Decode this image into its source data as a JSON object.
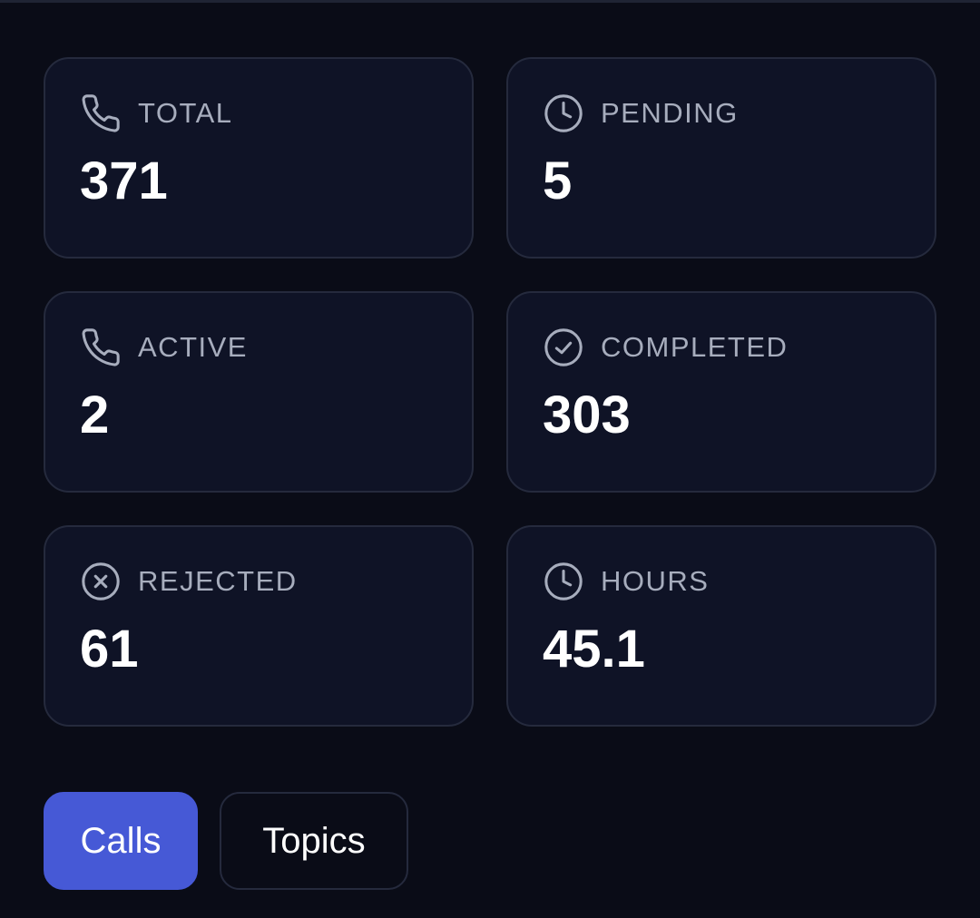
{
  "stats": [
    {
      "label": "TOTAL",
      "value": "371",
      "icon": "phone-icon"
    },
    {
      "label": "PENDING",
      "value": "5",
      "icon": "clock-icon"
    },
    {
      "label": "ACTIVE",
      "value": "2",
      "icon": "phone-icon"
    },
    {
      "label": "COMPLETED",
      "value": "303",
      "icon": "check-circle-icon"
    },
    {
      "label": "REJECTED",
      "value": "61",
      "icon": "x-circle-icon"
    },
    {
      "label": "HOURS",
      "value": "45.1",
      "icon": "clock-icon"
    }
  ],
  "tabs": {
    "calls_label": "Calls",
    "topics_label": "Topics",
    "active": "Calls"
  },
  "colors": {
    "background": "#0a0c17",
    "card": "#0f1326",
    "border": "#252a3d",
    "accent": "#4659d6",
    "label": "#a7adbd",
    "value": "#ffffff"
  }
}
